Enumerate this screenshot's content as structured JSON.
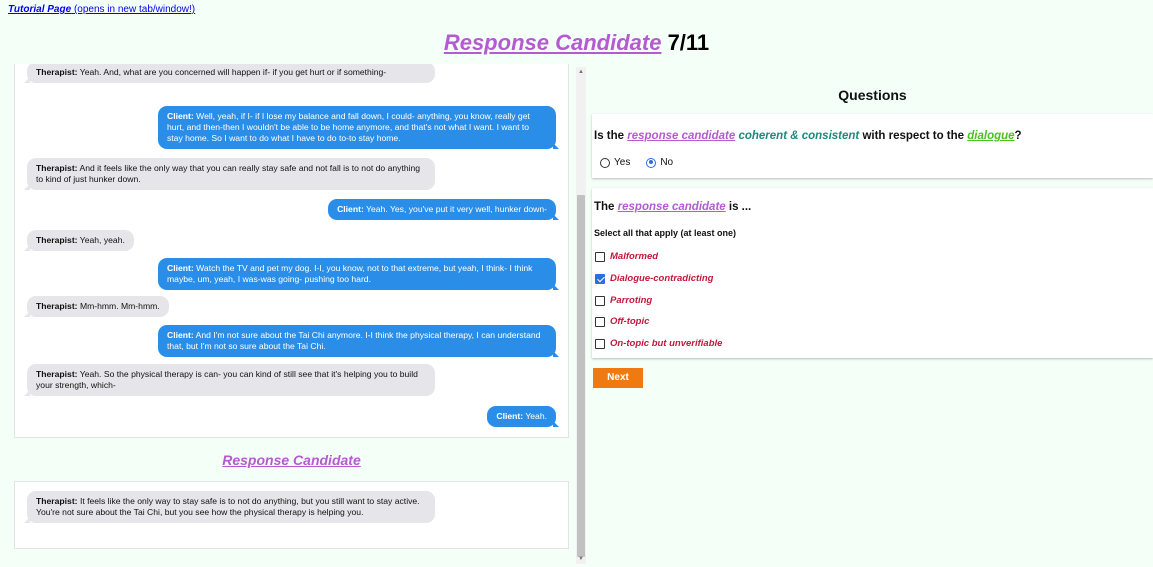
{
  "tutorial": {
    "link_label": "Tutorial Page",
    "link_note": "(opens in new tab/window!)"
  },
  "header": {
    "title": "Response Candidate",
    "counter": "7/11"
  },
  "dialogue": [
    {
      "speaker": "Therapist:",
      "text": "Yeah. And, what are you concerned will happen if- if you get hurt or if something-"
    },
    {
      "speaker": "Client:",
      "text": "Well, yeah, if I- if I lose my balance and fall down, I could- anything, you know, really get hurt, and then-then I wouldn't be able to be home anymore, and that's not what I want. I want to stay home. So I want to do what I have to do to-to stay home."
    },
    {
      "speaker": "Therapist:",
      "text": "And it feels like the only way that you can really stay safe and not fall is to not do anything to kind of just hunker down."
    },
    {
      "speaker": "Client:",
      "text": "Yeah. Yes, you've put it very well, hunker down-"
    },
    {
      "speaker": "Therapist:",
      "text": "Yeah, yeah."
    },
    {
      "speaker": "Client:",
      "text": "Watch the TV and pet my dog. I-I, you know, not to that extreme, but yeah, I think- I think maybe, um, yeah, I was-was going- pushing too hard."
    },
    {
      "speaker": "Therapist:",
      "text": "Mm-hmm. Mm-hmm."
    },
    {
      "speaker": "Client:",
      "text": "And I'm not sure about the Tai Chi anymore. I-I think the physical therapy, I can understand that, but I'm not so sure about the Tai Chi."
    },
    {
      "speaker": "Therapist:",
      "text": "Yeah. So the physical therapy is can- you can kind of still see that it's helping you to build your strength, which-"
    },
    {
      "speaker": "Client:",
      "text": "Yeah."
    }
  ],
  "response_candidate": {
    "heading": "Response Candidate",
    "speaker": "Therapist:",
    "text": "It feels like the only way to stay safe is to not do anything, but you still want to stay active. You're not sure about the Tai Chi, but you see how the physical therapy is helping you."
  },
  "questions": {
    "title": "Questions",
    "q1": {
      "prefix": "Is the",
      "rc": "response candidate",
      "middle": "coherent & consistent",
      "after": "with respect to the",
      "dialogue": "dialogue",
      "end": "?",
      "options": [
        {
          "label": "Yes",
          "selected": false
        },
        {
          "label": "No",
          "selected": true
        }
      ]
    },
    "q2": {
      "prefix": "The",
      "rc": "response candidate",
      "suffix": "is ...",
      "note": "Select all that apply (at least one)",
      "options": [
        {
          "label": "Malformed",
          "checked": false
        },
        {
          "label": "Dialogue-contradicting",
          "checked": true
        },
        {
          "label": "Parroting",
          "checked": false
        },
        {
          "label": "Off-topic",
          "checked": false
        },
        {
          "label": "On-topic but unverifiable",
          "checked": false
        }
      ]
    },
    "next_label": "Next"
  },
  "colors": {
    "accent_purple": "#b55ad1",
    "client_blue": "#2a8ee8",
    "next_orange": "#f07a12",
    "option_red": "#c4173b"
  }
}
